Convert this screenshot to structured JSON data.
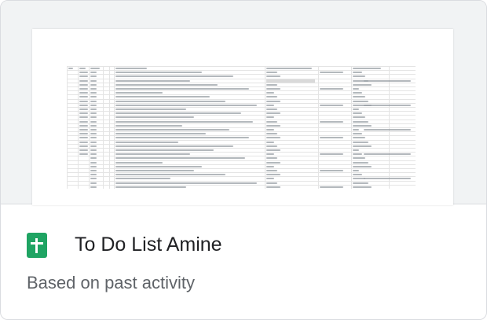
{
  "file_card": {
    "title": "To Do List Amine",
    "subtitle": "Based on past activity",
    "file_type_icon": "google-sheets-icon",
    "icon_color": "#1fa463"
  }
}
